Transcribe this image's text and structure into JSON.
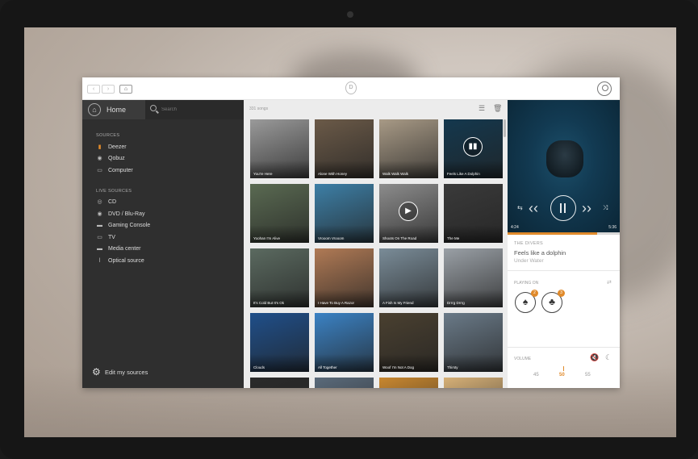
{
  "topbar": {
    "back_icon": "chevron-left-icon",
    "forward_icon": "chevron-right-icon",
    "home_icon": "home-icon",
    "logo_letter": "D",
    "user_icon": "user-icon"
  },
  "sidebar": {
    "home_label": "Home",
    "search_placeholder": "Search",
    "sources_title": "SOURCES",
    "sources": [
      {
        "label": "Deezer",
        "icon": "deezer-icon"
      },
      {
        "label": "Qobuz",
        "icon": "qobuz-icon"
      },
      {
        "label": "Computer",
        "icon": "computer-icon"
      }
    ],
    "live_title": "LIVE SOURCES",
    "live_sources": [
      {
        "label": "CD",
        "icon": "cd-icon"
      },
      {
        "label": "DVD / Blu-Ray",
        "icon": "dvd-icon"
      },
      {
        "label": "Gaming Console",
        "icon": "gamepad-icon"
      },
      {
        "label": "TV",
        "icon": "tv-icon"
      },
      {
        "label": "Media center",
        "icon": "media-center-icon"
      },
      {
        "label": "Optical source",
        "icon": "optical-icon"
      }
    ],
    "edit_label": "Edit my sources"
  },
  "content": {
    "song_count": "331 songs",
    "tiles": [
      {
        "label": "You're Here",
        "bg": "#9a9a9a"
      },
      {
        "label": "Alone With Honey",
        "bg": "#6b5a48"
      },
      {
        "label": "Walk Walk Walk",
        "bg": "#a89a86"
      },
      {
        "label": "Feels Like A Dolphin",
        "bg": "#14384e",
        "overlay": "equalizer"
      },
      {
        "label": "Yoohan I'm Alive",
        "bg": "#5a6a52"
      },
      {
        "label": "Vrooom Vrooom",
        "bg": "#3d7fa6"
      },
      {
        "label": "Shoots On The Road",
        "bg": "#8c8c8c",
        "overlay": "play"
      },
      {
        "label": "The Me",
        "bg": "#3a3a3a"
      },
      {
        "label": "It's Cold But It's Ok",
        "bg": "#5b6a60"
      },
      {
        "label": "I Have To Buy A Razor",
        "bg": "#b07a55"
      },
      {
        "label": "A Fish Is My Friend",
        "bg": "#7a8c98"
      },
      {
        "label": "Drrrg Drrrg",
        "bg": "#9aa0a6"
      },
      {
        "label": "Clouds",
        "bg": "#1f4f8a"
      },
      {
        "label": "All Together",
        "bg": "#3b82c4"
      },
      {
        "label": "Woof I'm Not A Dog",
        "bg": "#4a4030"
      },
      {
        "label": "Thirsty",
        "bg": "#6a7a88"
      },
      {
        "label": "",
        "bg": "#2a2a2a"
      },
      {
        "label": "",
        "bg": "#5a6a7a"
      },
      {
        "label": "",
        "bg": "#c8872f"
      },
      {
        "label": "",
        "bg": "#d6b077"
      }
    ]
  },
  "player": {
    "time_elapsed": "4:24",
    "time_total": "5:36",
    "progress": 0.8,
    "artist": "THE DIVERS",
    "title": "Feels like a dolphin",
    "album": "Under Water",
    "playing_on": "PLAYING ON",
    "devices": [
      {
        "icon": "speaker-icon",
        "badge": "2"
      },
      {
        "icon": "duck-icon",
        "badge": "3"
      }
    ],
    "volume_label": "VOLUME",
    "volume_ticks": [
      "45",
      "50",
      "55"
    ],
    "volume_value": 50,
    "accent": "#e08a2b"
  }
}
